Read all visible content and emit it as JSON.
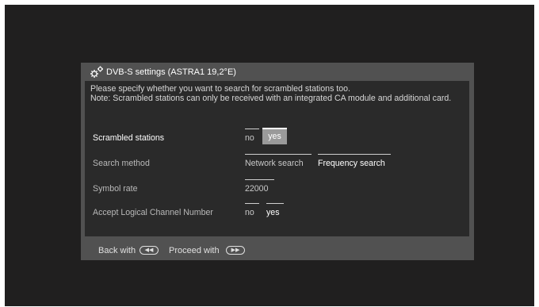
{
  "dialog": {
    "title": "DVB-S settings (ASTRA1 19,2°E)",
    "description": "Please specify whether you want to search for scrambled stations too.",
    "note": "Note: Scrambled stations can only be received with an integrated CA module and additional card."
  },
  "rows": {
    "scrambled": {
      "label": "Scrambled stations",
      "options": [
        "no",
        "yes"
      ],
      "selected": "yes"
    },
    "search_method": {
      "label": "Search method",
      "options": [
        "Network search",
        "Frequency search"
      ],
      "selected": "Frequency search"
    },
    "symbol_rate": {
      "label": "Symbol rate",
      "value": "22000"
    },
    "lcn": {
      "label": "Accept Logical Channel Number",
      "options": [
        "no",
        "yes"
      ],
      "selected": "yes"
    }
  },
  "footer": {
    "back_label": "Back with",
    "back_key_icon": "rewind-key-icon",
    "proceed_label": "Proceed with",
    "proceed_key_icon": "fast-forward-key-icon"
  },
  "colors": {
    "screen_bg": "#201f1f",
    "dialog_bg": "#515151",
    "content_bg": "#2a2a2a",
    "highlight_bg": "#9a9a9a"
  }
}
